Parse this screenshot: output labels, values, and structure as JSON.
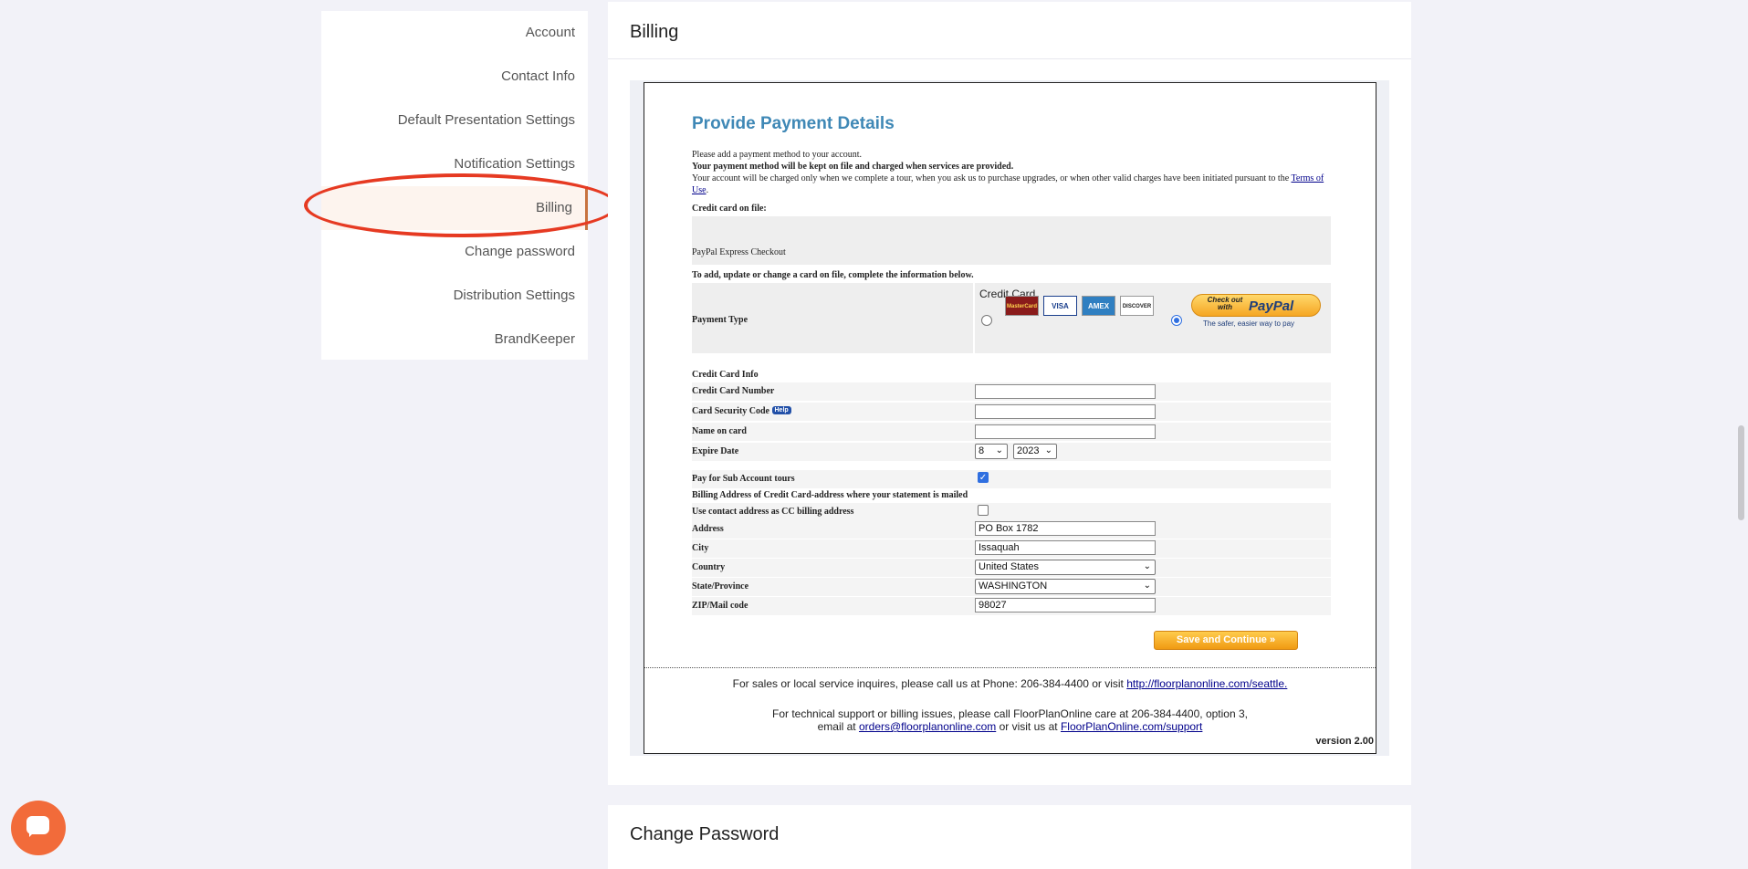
{
  "sidebar": {
    "items": [
      {
        "label": "Account"
      },
      {
        "label": "Contact Info"
      },
      {
        "label": "Default Presentation Settings"
      },
      {
        "label": "Notification Settings"
      },
      {
        "label": "Billing"
      },
      {
        "label": "Change password"
      },
      {
        "label": "Distribution Settings"
      },
      {
        "label": "BrandKeeper"
      }
    ],
    "active": "Billing"
  },
  "billing": {
    "heading": "Billing",
    "panel": {
      "title": "Provide Payment Details",
      "intro_line1": "Please add a payment method to your account.",
      "intro_line2": "Your payment method will be kept on file and charged when services are provided.",
      "intro_line3": "Your account will be charged only when we complete a tour, when you ask us to purchase upgrades, or when other valid charges have been initiated pursuant to the",
      "terms_link": "Terms of Use",
      "intro_period": ".",
      "card_on_file_label": "Credit card on file:",
      "card_on_file_value": "PayPal Express Checkout",
      "update_instructions": "To add, update or change a card on file, complete the information below.",
      "payment_type_label": "Payment Type",
      "payment_option_credit": "Credit Card",
      "card_logos": [
        "MasterCard",
        "VISA",
        "AMEX",
        "DISCOVER"
      ],
      "paypal_small": "Check out with",
      "paypal_big": "PayPal",
      "paypal_tagline": "The safer, easier way to pay",
      "selected_payment": "paypal",
      "cc_info_label": "Credit Card Info",
      "cc_number_label": "Credit Card Number",
      "cc_number_value": "",
      "security_code_label": "Card Security Code",
      "help_label": "Help",
      "security_code_value": "",
      "name_on_card_label": "Name on card",
      "name_on_card_value": "",
      "expire_label": "Expire Date",
      "expire_month": "8",
      "expire_year": "2023",
      "sub_account_label": "Pay for Sub Account tours",
      "sub_account_checked": true,
      "billing_address_heading": "Billing Address of Credit Card-address where your statement is mailed",
      "use_contact_label": "Use contact address as CC billing address",
      "use_contact_checked": false,
      "address_label": "Address",
      "address_value": "PO Box 1782",
      "city_label": "City",
      "city_value": "Issaquah",
      "country_label": "Country",
      "country_value": "United States",
      "state_label": "State/Province",
      "state_value": "WASHINGTON",
      "zip_label": "ZIP/Mail code",
      "zip_value": "98027",
      "save_button": "Save and Continue",
      "sales_text": "For sales or local service inquires, please call us at Phone: 206-384-4400 or visit",
      "sales_link": "http://floorplanonline.com/seattle.",
      "support_text1": "For technical support or billing issues, please call FloorPlanOnline care at 206-384-4400, option 3,",
      "support_text2a": "email at",
      "support_email": "orders@floorplanonline.com",
      "support_text2b": "or visit us at",
      "support_link": "FloorPlanOnline.com/support",
      "version": "version 2.00"
    }
  },
  "change_password": {
    "heading": "Change Password"
  },
  "colors": {
    "accent": "#c8733f",
    "highlight_ring": "#e63a22",
    "panel_title": "#3f88b6",
    "chat_button": "#f26b3a"
  }
}
